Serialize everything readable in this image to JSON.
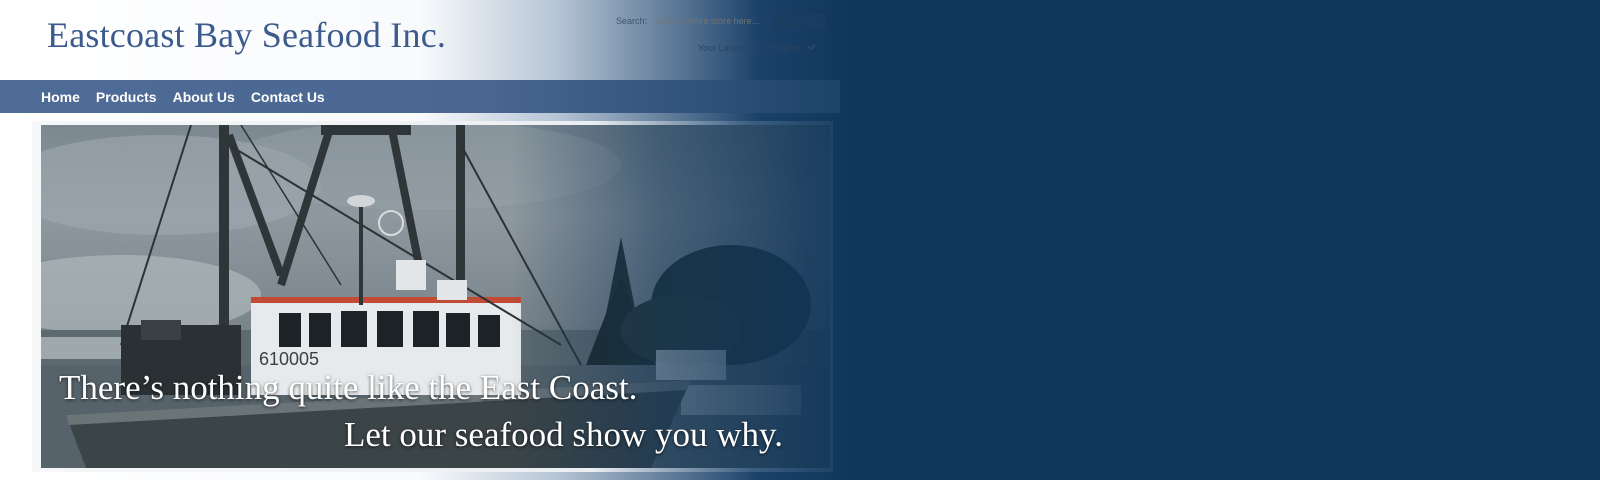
{
  "header": {
    "logo_text": "Eastcoast Bay Seafood Inc.",
    "search": {
      "label": "Search:",
      "placeholder": "Search entire store here...",
      "button_label": "Search"
    },
    "language": {
      "label": "Your Language:",
      "selected": "English"
    }
  },
  "nav": {
    "items": [
      {
        "label": "Home"
      },
      {
        "label": "Products"
      },
      {
        "label": "About Us"
      },
      {
        "label": "Contact Us"
      }
    ]
  },
  "hero": {
    "line1": "There’s nothing quite like the East Coast.",
    "line2": "Let our seafood show you why.",
    "image_icon": "fishing-boat-photo"
  },
  "colors": {
    "page_background": "#10365a",
    "logo": "#3c5a8c",
    "nav_bar": "#4f6b97",
    "nav_text": "#ffffff"
  }
}
